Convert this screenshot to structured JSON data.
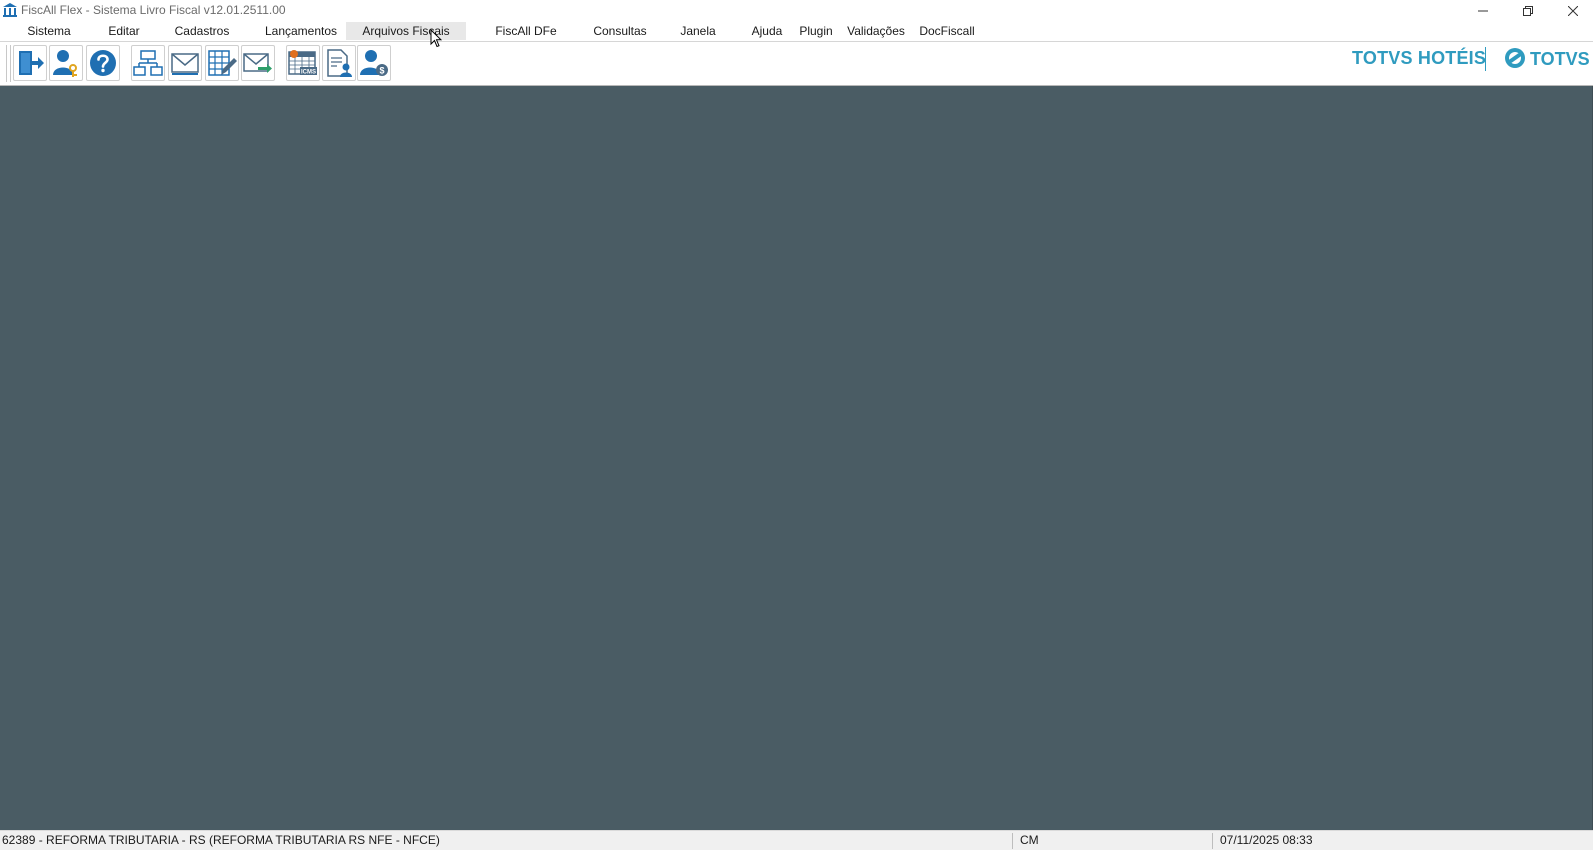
{
  "window": {
    "title": "FiscAll Flex - Sistema Livro Fiscal v12.01.2511.00",
    "icon": "building-columns-icon",
    "controls": [
      "minimize-icon",
      "maximize-icon",
      "close-icon"
    ]
  },
  "menu": {
    "items": [
      {
        "label": "Sistema"
      },
      {
        "label": "Editar"
      },
      {
        "label": "Cadastros"
      },
      {
        "label": "Lançamentos"
      },
      {
        "label": "Arquivos Fiscais"
      },
      {
        "label": "FiscAll DFe"
      },
      {
        "label": "Consultas"
      },
      {
        "label": "Janela"
      },
      {
        "label": "Ajuda"
      },
      {
        "label": "Plugin"
      },
      {
        "label": "Validações"
      },
      {
        "label": "DocFiscall"
      }
    ],
    "hovered": "Arquivos Fiscais"
  },
  "toolbar": {
    "buttons": [
      {
        "icon": "exit-door-icon"
      },
      {
        "icon": "user-key-icon"
      },
      {
        "icon": "help-icon"
      },
      {
        "icon": "org-chart-icon"
      },
      {
        "icon": "envelope-icon"
      },
      {
        "icon": "spreadsheet-edit-icon"
      },
      {
        "icon": "send-mail-icon"
      },
      {
        "icon": "calendar-icms-icon"
      },
      {
        "icon": "document-user-icon"
      },
      {
        "icon": "user-money-icon"
      }
    ],
    "icms_badge": "ICMS"
  },
  "branding": {
    "product": "TOTVS HOTÉIS",
    "company": "TOTVS"
  },
  "colors": {
    "workspace": "#4a5c64",
    "brand": "#2f9bbf",
    "icon_blue": "#1f6fb2"
  },
  "statusbar": {
    "company": "62389 - REFORMA TRIBUTARIA - RS (REFORMA TRIBUTARIA RS NFE - NFCE)",
    "mode": "CM",
    "datetime": "07/11/2025 08:33"
  }
}
